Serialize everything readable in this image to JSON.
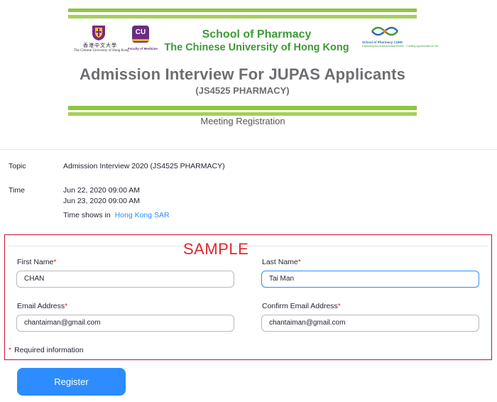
{
  "banner": {
    "cuhk_cn": "香港中文大學",
    "cuhk_en": "The Chinese University of Hong Kong",
    "fom_badge": "CU",
    "fom_name": "Faculty of Medicine",
    "school_line1": "School of Pharmacy",
    "school_line2": "The Chinese University of Hong Kong",
    "sop_name": "School of Pharmacy CUHK",
    "sop_tagline": "Expanding the pharmaceutical frontier · Creating opportunities for life",
    "title": "Admission Interview For JUPAS Applicants",
    "subtitle": "(JS4525 PHARMACY)"
  },
  "page_heading": "Meeting Registration",
  "details": {
    "topic_label": "Topic",
    "topic_value": "Admission Interview 2020 (JS4525 PHARMACY)",
    "time_label": "Time",
    "time_1": "Jun 22, 2020 09:00 AM",
    "time_2": "Jun 23, 2020 09:00 AM",
    "timezone_prefix": "Time shows in",
    "timezone_link": "Hong Kong SAR"
  },
  "sample_watermark": "SAMPLE",
  "form": {
    "first_name_label": "First Name",
    "first_name_value": "CHAN",
    "last_name_label": "Last Name",
    "last_name_value": "Tai Man",
    "email_label": "Email Address",
    "email_value": "chantaiman@gmail.com",
    "confirm_email_label": "Confirm Email Address",
    "confirm_email_value": "chantaiman@gmail.com",
    "required_star": "*",
    "required_note": "Required information"
  },
  "register_label": "Register",
  "colors": {
    "accent": "#2d8cff",
    "banner_green": "#8dc63f",
    "sample_red": "#c8102e"
  }
}
